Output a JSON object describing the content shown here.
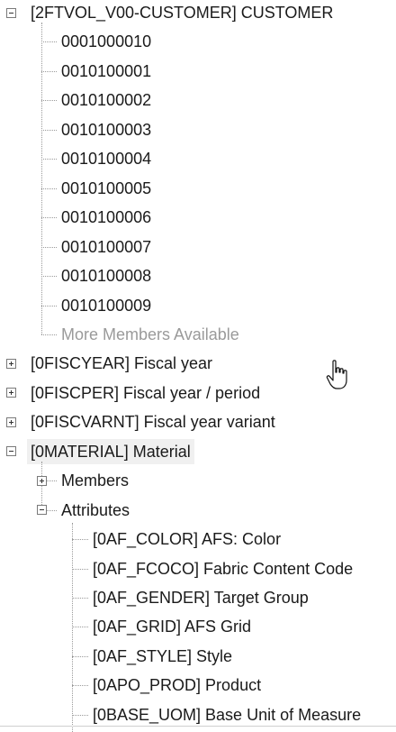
{
  "tree": {
    "customer": {
      "label": "[2FTVOL_V00-CUSTOMER] CUSTOMER",
      "members": [
        "0001000010",
        "0010100001",
        "0010100002",
        "0010100003",
        "0010100004",
        "0010100005",
        "0010100006",
        "0010100007",
        "0010100008",
        "0010100009"
      ],
      "more": "More Members Available"
    },
    "collapsed_nodes": [
      "[0FISCYEAR] Fiscal year",
      "[0FISCPER] Fiscal year / period",
      "[0FISCVARNT] Fiscal year variant"
    ],
    "material": {
      "label": "[0MATERIAL] Material",
      "members_label": "Members",
      "attributes_label": "Attributes",
      "attributes": [
        "[0AF_COLOR] AFS: Color",
        "[0AF_FCOCO] Fabric Content Code",
        "[0AF_GENDER] Target Group",
        "[0AF_GRID] AFS Grid",
        "[0AF_STYLE] Style",
        "[0APO_PROD] Product",
        "[0BASE_UOM] Base Unit of Measure"
      ]
    },
    "icons": {
      "expanded": "minus-box-icon",
      "collapsed": "plus-box-icon",
      "cursor": "hand-pointer-icon"
    }
  }
}
